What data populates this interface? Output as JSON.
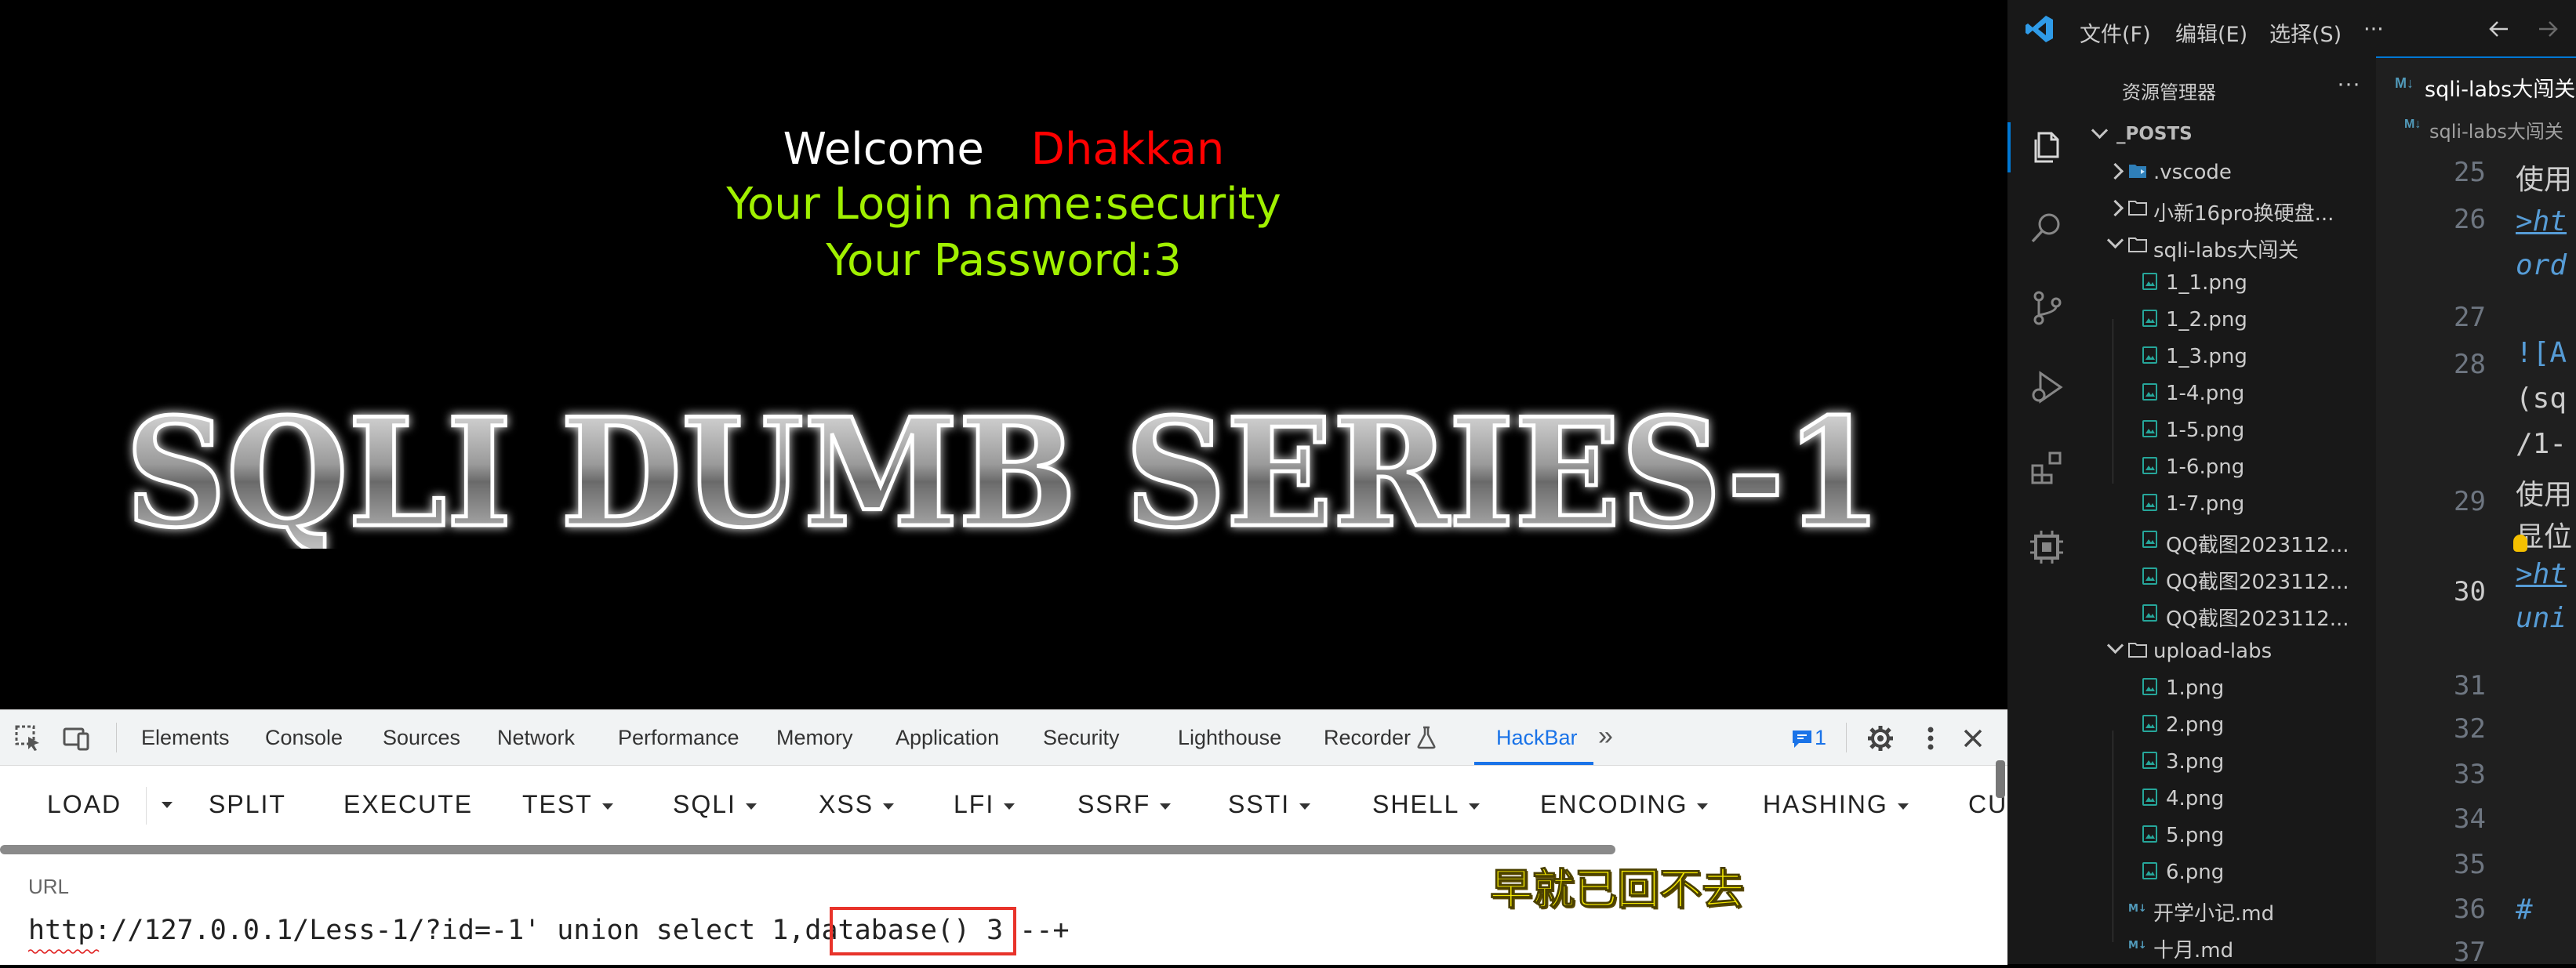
{
  "page": {
    "welcome": "Welcome",
    "username": "Dhakkan",
    "login_name": "Your Login name:security",
    "password": "Your Password:3",
    "banner": "SQLI DUMB SERIES-1"
  },
  "devtools": {
    "tabs": [
      "Elements",
      "Console",
      "Sources",
      "Network",
      "Performance",
      "Memory",
      "Application",
      "Security",
      "Lighthouse",
      "Recorder",
      "HackBar"
    ],
    "active_tab": "HackBar",
    "more_tabs": "»",
    "issues_count": "1"
  },
  "hackbar": {
    "buttons": [
      "LOAD",
      "SPLIT",
      "EXECUTE",
      "TEST",
      "SQLI",
      "XSS",
      "LFI",
      "SSRF",
      "SSTI",
      "SHELL",
      "ENCODING",
      "HASHING",
      "CU"
    ],
    "url_label": "URL",
    "url_value": "http://127.0.0.1/Less-1/?id=-1' union select 1,database() 3 --+"
  },
  "annotation": {
    "text": "早就已回不去",
    "color": "#f2e600"
  },
  "vscode": {
    "menu": [
      "文件(F)",
      "编辑(E)",
      "选择(S)",
      "···"
    ],
    "explorer_title": "资源管理器",
    "explorer_more": "···",
    "section": "_POSTS",
    "tree": [
      {
        "label": ".vscode",
        "type": "folder",
        "expanded": false,
        "depth": 1
      },
      {
        "label": "小新16pro换硬盘...",
        "type": "folder",
        "expanded": false,
        "depth": 1
      },
      {
        "label": "sqli-labs大闯关",
        "type": "folder",
        "expanded": true,
        "depth": 1
      },
      {
        "label": "1_1.png",
        "type": "image",
        "depth": 2
      },
      {
        "label": "1_2.png",
        "type": "image",
        "depth": 2
      },
      {
        "label": "1_3.png",
        "type": "image",
        "depth": 2
      },
      {
        "label": "1-4.png",
        "type": "image",
        "depth": 2
      },
      {
        "label": "1-5.png",
        "type": "image",
        "depth": 2
      },
      {
        "label": "1-6.png",
        "type": "image",
        "depth": 2
      },
      {
        "label": "1-7.png",
        "type": "image",
        "depth": 2
      },
      {
        "label": "QQ截图2023112...",
        "type": "image",
        "depth": 2
      },
      {
        "label": "QQ截图2023112...",
        "type": "image",
        "depth": 2
      },
      {
        "label": "QQ截图2023112...",
        "type": "image",
        "depth": 2
      },
      {
        "label": "upload-labs",
        "type": "folder",
        "expanded": true,
        "depth": 1
      },
      {
        "label": "1.png",
        "type": "image",
        "depth": 2
      },
      {
        "label": "2.png",
        "type": "image",
        "depth": 2
      },
      {
        "label": "3.png",
        "type": "image",
        "depth": 2
      },
      {
        "label": "4.png",
        "type": "image",
        "depth": 2
      },
      {
        "label": "5.png",
        "type": "image",
        "depth": 2
      },
      {
        "label": "6.png",
        "type": "image",
        "depth": 2
      },
      {
        "label": "开学小记.md",
        "type": "markdown",
        "depth": 1
      },
      {
        "label": "十月.md",
        "type": "markdown",
        "depth": 1
      }
    ],
    "tab_title": "sqli-labs大闯关",
    "breadcrumb": "sqli-labs大闯关",
    "line_numbers": [
      "25",
      "26",
      "27",
      "28",
      "29",
      "30",
      "31",
      "32",
      "33",
      "34",
      "35",
      "36",
      "37"
    ],
    "current_line": "30",
    "code_fragments": [
      {
        "text": "使用",
        "color": "#cccccc"
      },
      {
        "text": ">ht",
        "color": "#569cd6"
      },
      {
        "text": "ord",
        "color": "#569cd6"
      },
      {
        "text": "![A",
        "color": "#569cd6"
      },
      {
        "text": "(sq",
        "color": "#cccccc"
      },
      {
        "text": "/1-",
        "color": "#cccccc"
      },
      {
        "text": "使用",
        "color": "#cccccc"
      },
      {
        "text": "显位",
        "color": "#cccccc"
      },
      {
        "text": ">ht",
        "color": "#569cd6"
      },
      {
        "text": "uni",
        "color": "#569cd6"
      },
      {
        "text": "# ",
        "color": "#569cd6"
      }
    ]
  }
}
